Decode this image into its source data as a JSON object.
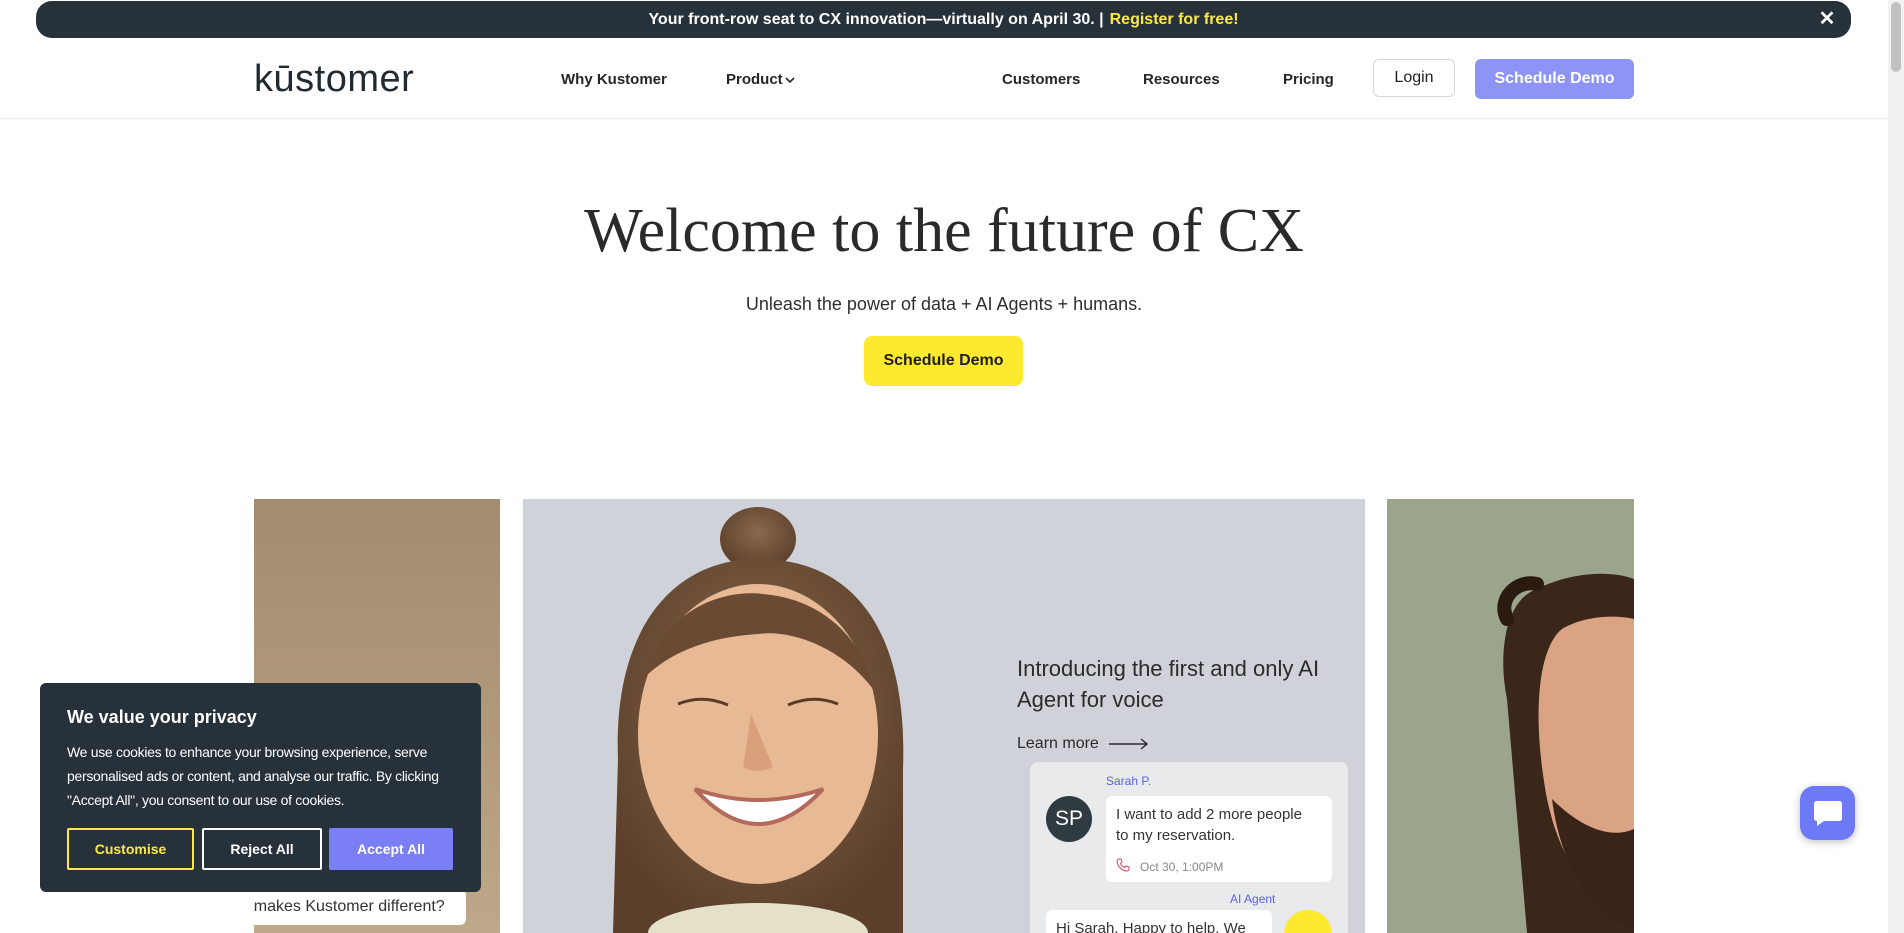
{
  "announcement": {
    "text": "Your front-row seat to CX innovation—virtually on April 30. |",
    "link": "Register for free!",
    "close_icon": "close-icon"
  },
  "nav": {
    "logo": "kūstomer",
    "items": [
      "Why Kustomer",
      "Product",
      "Customers",
      "Resources",
      "Pricing"
    ],
    "product_chevron": "⌄",
    "login": "Login",
    "schedule_demo": "Schedule Demo"
  },
  "hero": {
    "title": "Welcome to the future of CX",
    "subtitle": "Unleash the power of data + AI Agents + humans.",
    "cta": "Schedule Demo"
  },
  "cards": {
    "left_pill": "at makes Kustomer different?",
    "promo_title": "Introducing the first and only AI Agent for voice",
    "learn_more": "Learn more",
    "chat": {
      "user_name": "Sarah P.",
      "user_initials": "SP",
      "user_message": "I want to add 2 more people to my reservation.",
      "timestamp": "Oct 30, 1:00PM",
      "ai_name": "AI Agent",
      "ai_message": "Hi Sarah. Happy to help. We"
    }
  },
  "cookie": {
    "title": "We value your privacy",
    "body": "We use cookies to enhance your browsing experience, serve personalised ads or content, and analyse our traffic. By clicking \"Accept All\", you consent to our use of cookies.",
    "customise": "Customise",
    "reject": "Reject All",
    "accept": "Accept All"
  },
  "colors": {
    "announcement_bg": "#26313a",
    "announcement_link": "#fde84a",
    "primary_button": "#8d94f6",
    "hero_cta": "#fde92e",
    "accept_button": "#7b7ff5"
  }
}
